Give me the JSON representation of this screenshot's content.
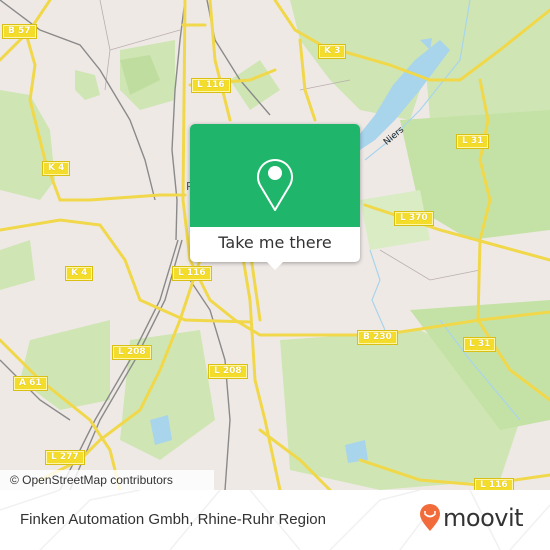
{
  "map": {
    "attribution": "© OpenStreetMap contributors",
    "place_label": "R",
    "river_label": "Niers",
    "road_labels": [
      {
        "id": "b57",
        "text": "B 57"
      },
      {
        "id": "k3",
        "text": "K 3"
      },
      {
        "id": "l116-top",
        "text": "L 116"
      },
      {
        "id": "l31-top",
        "text": "L 31"
      },
      {
        "id": "k4-top",
        "text": "K 4"
      },
      {
        "id": "l370",
        "text": "L 370"
      },
      {
        "id": "k4-mid",
        "text": "K 4"
      },
      {
        "id": "l116-mid",
        "text": "L 116"
      },
      {
        "id": "b230",
        "text": "B 230"
      },
      {
        "id": "l31-mid",
        "text": "L 31"
      },
      {
        "id": "l208-left",
        "text": "L 208"
      },
      {
        "id": "l208-right",
        "text": "L 208"
      },
      {
        "id": "a61",
        "text": "A 61"
      },
      {
        "id": "l277",
        "text": "L 277"
      },
      {
        "id": "l116-bottom",
        "text": "L 116"
      }
    ]
  },
  "popup": {
    "icon": "map-pin-icon",
    "button_label": "Take me there",
    "accent_color": "#1fb66b"
  },
  "footer": {
    "title": "Finken Automation Gmbh, Rhine-Ruhr Region",
    "brand": "moovit",
    "brand_icon": "moovit-logo-icon",
    "brand_color": "#f26b3a"
  }
}
